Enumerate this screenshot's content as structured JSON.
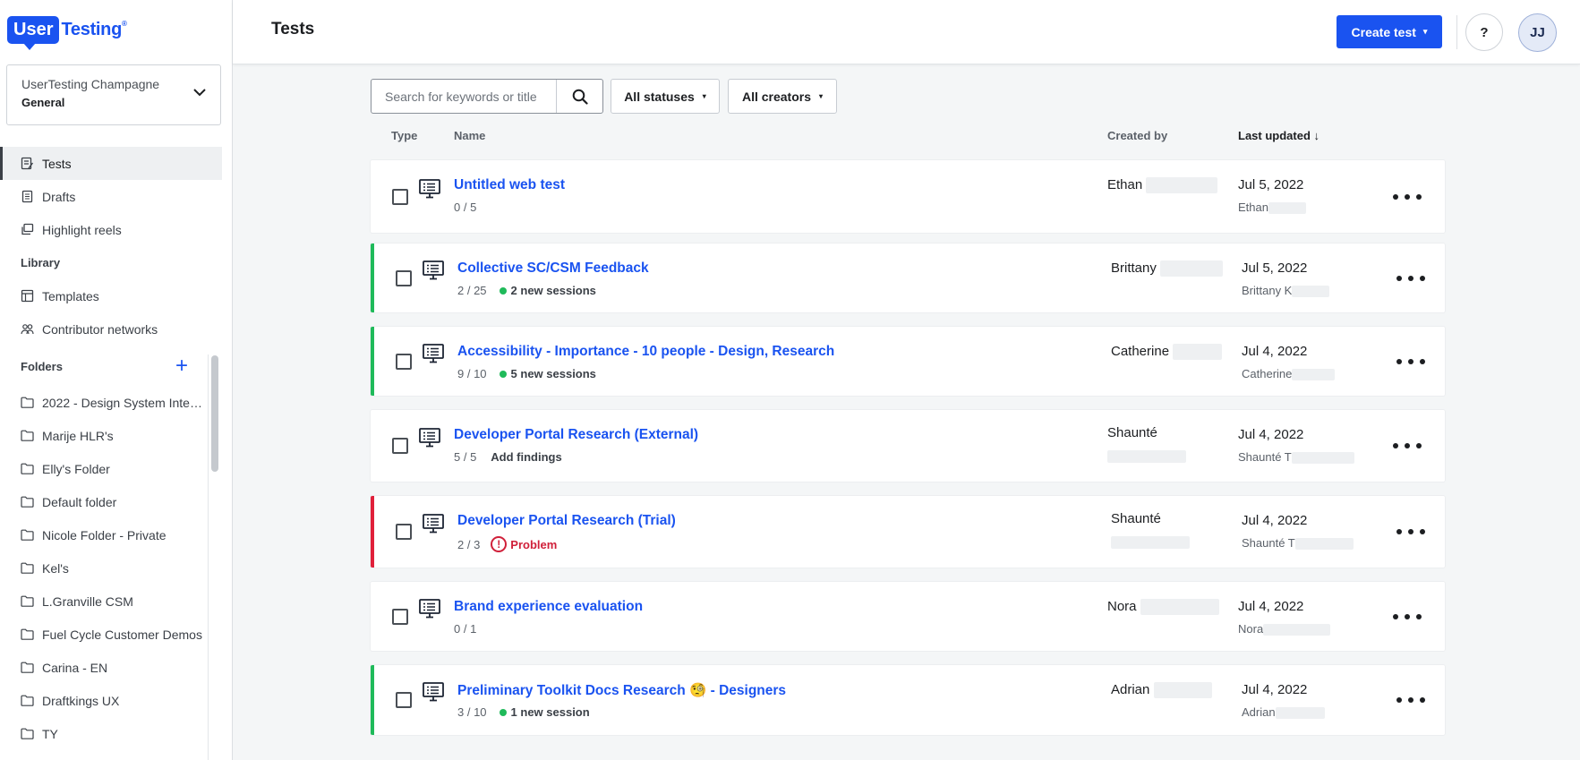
{
  "brand": {
    "logo_part1": "User",
    "logo_part2": "Testing"
  },
  "workspace": {
    "org": "UserTesting Champagne",
    "name": "General"
  },
  "nav": {
    "tests": "Tests",
    "drafts": "Drafts",
    "highlight_reels": "Highlight reels",
    "library_heading": "Library",
    "templates": "Templates",
    "contributor_networks": "Contributor networks",
    "folders_heading": "Folders",
    "add_folder": "+"
  },
  "folders": [
    "2022 - Design System Inter...",
    "Marije HLR's",
    "Elly's Folder",
    "Default folder",
    "Nicole Folder - Private",
    "Kel's",
    "L.Granville CSM",
    "Fuel Cycle Customer Demos",
    "Carina - EN",
    "Draftkings UX",
    "TY"
  ],
  "header": {
    "title": "Tests",
    "create_label": "Create test",
    "create_caret": "▾",
    "help_label": "?",
    "avatar_initials": "JJ"
  },
  "filters": {
    "search_placeholder": "Search for keywords or title",
    "status_label": "All statuses",
    "creator_label": "All creators",
    "caret": "▾"
  },
  "table": {
    "col_type": "Type",
    "col_name": "Name",
    "col_created_by": "Created by",
    "col_last_updated": "Last updated",
    "sort_indicator": "↓"
  },
  "rows": [
    {
      "name": "Untitled web test",
      "progress": "0 / 5",
      "creator": "Ethan",
      "date": "Jul 5, 2022",
      "updater": "Ethan"
    },
    {
      "name": "Collective SC/CSM Feedback",
      "progress": "2 / 25",
      "sessions": "2 new sessions",
      "creator": "Brittany",
      "date": "Jul 5, 2022",
      "updater": "Brittany K"
    },
    {
      "name": "Accessibility - Importance - 10 people - Design, Research",
      "progress": "9 / 10",
      "sessions": "5 new sessions",
      "creator": "Catherine",
      "date": "Jul 4, 2022",
      "updater": "Catherine"
    },
    {
      "name": "Developer Portal Research (External)",
      "progress": "5 / 5",
      "findings": "Add findings",
      "creator": "Shaunté",
      "date": "Jul 4, 2022",
      "updater": "Shaunté T"
    },
    {
      "name": "Developer Portal Research (Trial)",
      "progress": "2 / 3",
      "problem": "Problem",
      "problem_icon": "!",
      "creator": "Shaunté",
      "date": "Jul 4, 2022",
      "updater": "Shaunté T"
    },
    {
      "name": "Brand experience evaluation",
      "progress": "0 / 1",
      "creator": "Nora",
      "date": "Jul 4, 2022",
      "updater": "Nora"
    },
    {
      "name": "Preliminary Toolkit Docs Research 🧐 - Designers",
      "progress": "3 / 10",
      "sessions": "1 new session",
      "creator": "Adrian",
      "date": "Jul 4, 2022",
      "updater": "Adrian"
    }
  ],
  "colors": {
    "brand_blue": "#1a53f0",
    "success_green": "#1fba5a",
    "error_red": "#e0203a"
  }
}
